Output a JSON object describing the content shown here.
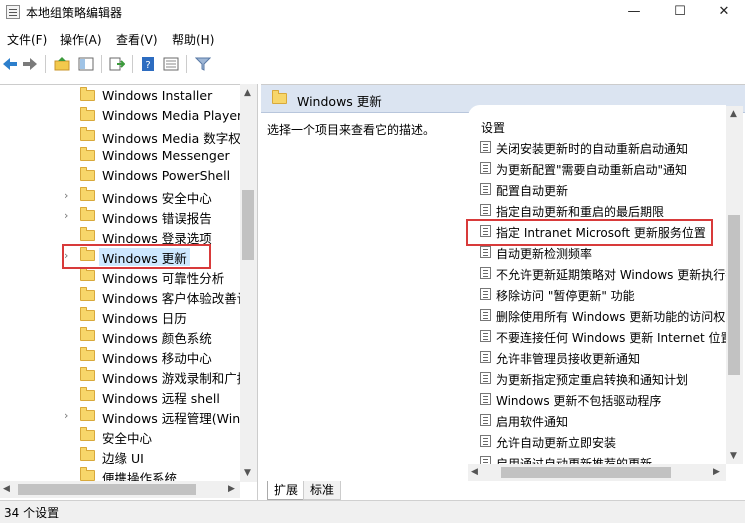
{
  "window": {
    "title": "本地组策略编辑器",
    "minimize": "—",
    "maximize": "☐",
    "close": "✕"
  },
  "menu": [
    "文件(F)",
    "操作(A)",
    "查看(V)",
    "帮助(H)"
  ],
  "toolbar": {
    "icons": [
      "back-arrow-icon",
      "forward-arrow-icon",
      "up-folder-icon",
      "show-hide-tree-icon",
      "export-list-icon",
      "help-icon",
      "properties-icon",
      "filter-icon"
    ]
  },
  "tree": {
    "items": [
      {
        "label": "Windows Installer",
        "expandable": false
      },
      {
        "label": "Windows Media Player",
        "expandable": false
      },
      {
        "label": "Windows Media 数字权限管理",
        "expandable": false
      },
      {
        "label": "Windows Messenger",
        "expandable": false
      },
      {
        "label": "Windows PowerShell",
        "expandable": false
      },
      {
        "label": "Windows 安全中心",
        "expandable": true
      },
      {
        "label": "Windows 错误报告",
        "expandable": true
      },
      {
        "label": "Windows 登录选项",
        "expandable": false
      },
      {
        "label": "Windows 更新",
        "expandable": true,
        "selected": true
      },
      {
        "label": "Windows 可靠性分析",
        "expandable": false
      },
      {
        "label": "Windows 客户体验改善计划",
        "expandable": false
      },
      {
        "label": "Windows 日历",
        "expandable": false
      },
      {
        "label": "Windows 颜色系统",
        "expandable": false
      },
      {
        "label": "Windows 移动中心",
        "expandable": false
      },
      {
        "label": "Windows 游戏录制和广播",
        "expandable": false
      },
      {
        "label": "Windows 远程 shell",
        "expandable": false
      },
      {
        "label": "Windows 远程管理(WinRM)",
        "expandable": true
      },
      {
        "label": "安全中心",
        "expandable": false
      },
      {
        "label": "边缘 UI",
        "expandable": false
      },
      {
        "label": "便携操作系统",
        "expandable": false
      }
    ]
  },
  "content": {
    "header": "Windows 更新",
    "description": "选择一个项目来查看它的描述。",
    "column_header": "设置",
    "settings": [
      "关闭安装更新时的自动重新启动通知",
      "为更新配置\"需要自动重新启动\"通知",
      "配置自动更新",
      "指定自动更新和重启的最后期限",
      "指定 Intranet Microsoft 更新服务位置",
      "自动更新检测频率",
      "不允许更新延期策略对 Windows 更新执行扫描",
      "移除访问 \"暂停更新\" 功能",
      "删除使用所有 Windows 更新功能的访问权限",
      "不要连接任何 Windows 更新 Internet 位置",
      "允许非管理员接收更新通知",
      "为更新指定预定重启转换和通知计划",
      "Windows 更新不包括驱动程序",
      "启用软件通知",
      "允许自动更新立即安装",
      "启用通过自动更新推荐的更新"
    ],
    "tabs": [
      "扩展",
      "标准"
    ]
  },
  "status": "34 个设置",
  "colors": {
    "highlight_box": "#d83a3a",
    "selected_bg": "#cde8ff",
    "header_bg": "#dbe4f1"
  }
}
